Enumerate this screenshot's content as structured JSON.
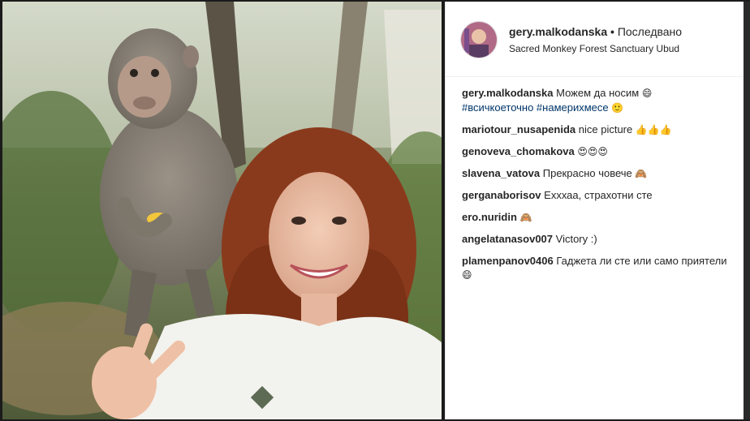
{
  "post": {
    "username": "gery.malkodanska",
    "separator": "•",
    "follow_label": "Последвано",
    "location": "Sacred Monkey Forest Sanctuary Ubud"
  },
  "comments": [
    {
      "user": "gery.malkodanska",
      "text": "Можем да носим",
      "emoji": "😄",
      "tags": "#всичкоеточно #намерихмесе",
      "tail_emoji": "🙂"
    },
    {
      "user": "mariotour_nusapenida",
      "text": "nice picture",
      "emoji": "👍👍👍"
    },
    {
      "user": "genoveva_chomakova",
      "text": "",
      "emoji": "😍😍😍"
    },
    {
      "user": "slavena_vatova",
      "text": "Прекрасно човече",
      "emoji": "🙈"
    },
    {
      "user": "gerganaborisov",
      "text": "Ехххаа, страхотни сте",
      "emoji": ""
    },
    {
      "user": "ero.nuridin",
      "text": "",
      "emoji": "🙈"
    },
    {
      "user": "angelatanasov007",
      "text": "Victory :)",
      "emoji": ""
    },
    {
      "user": "plamenpanov0406",
      "text": "Гаджета ли сте или само приятели",
      "emoji": "😄"
    }
  ],
  "colors": {
    "text": "#262626",
    "hashtag": "#003569",
    "panel_bg": "#ffffff"
  },
  "image": {
    "subject": "photo-woman-with-monkey"
  }
}
